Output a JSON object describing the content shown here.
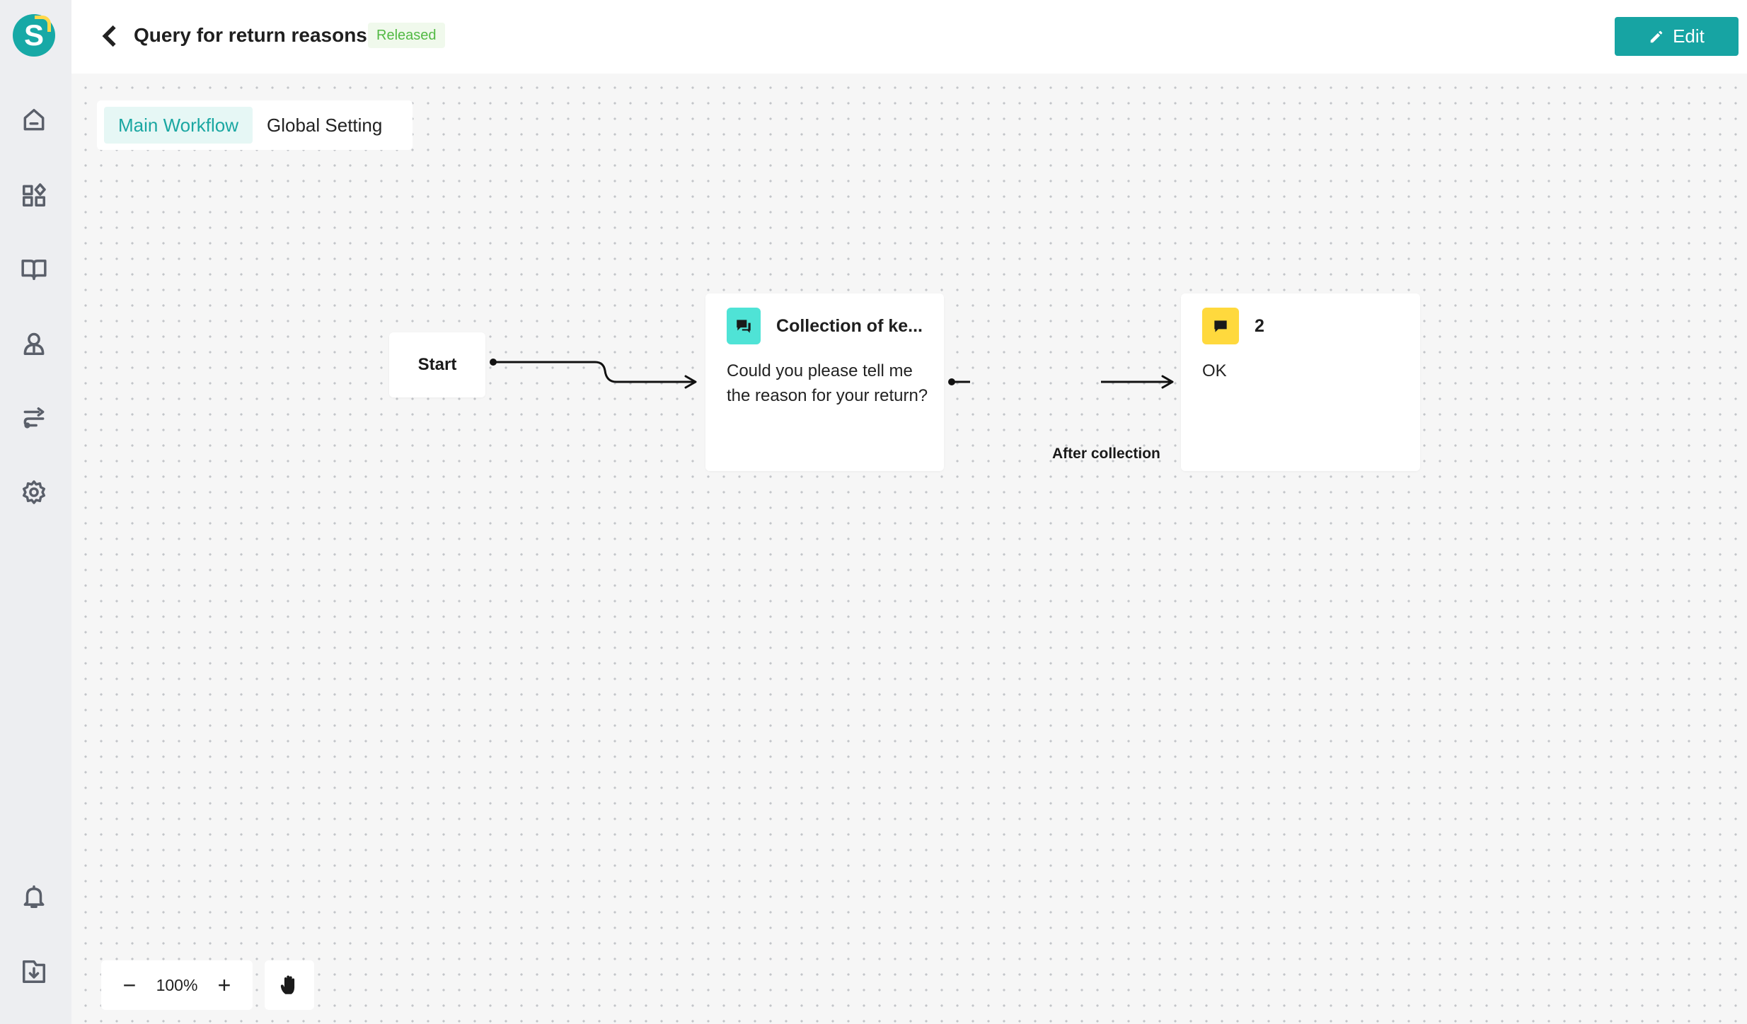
{
  "header": {
    "title": "Query for return reasons",
    "status": "Released",
    "edit_label": "Edit"
  },
  "tabs": [
    {
      "label": "Main Workflow",
      "active": true
    },
    {
      "label": "Global Setting",
      "active": false
    }
  ],
  "nodes": {
    "start": {
      "label": "Start"
    },
    "collect": {
      "title": "Collection of ke...",
      "body": "Could you please tell me the reason for your return?",
      "icon": "chat-bubbles-icon",
      "icon_color": "#4fe3d6"
    },
    "reply": {
      "title": "2",
      "body": "OK",
      "icon": "chat-bubble-icon",
      "icon_color": "#ffd93d"
    }
  },
  "edges": {
    "collect_to_reply_label": "After collection"
  },
  "zoom": {
    "minus": "−",
    "level": "100%",
    "plus": "+"
  },
  "colors": {
    "accent": "#17a4a3",
    "status_text": "#52b944",
    "status_bg": "#f0f9ec"
  },
  "sidebar": {
    "items": [
      "home-icon",
      "apps-icon",
      "book-icon",
      "user-icon",
      "flow-icon",
      "gear-icon",
      "bell-icon",
      "download-icon"
    ]
  }
}
